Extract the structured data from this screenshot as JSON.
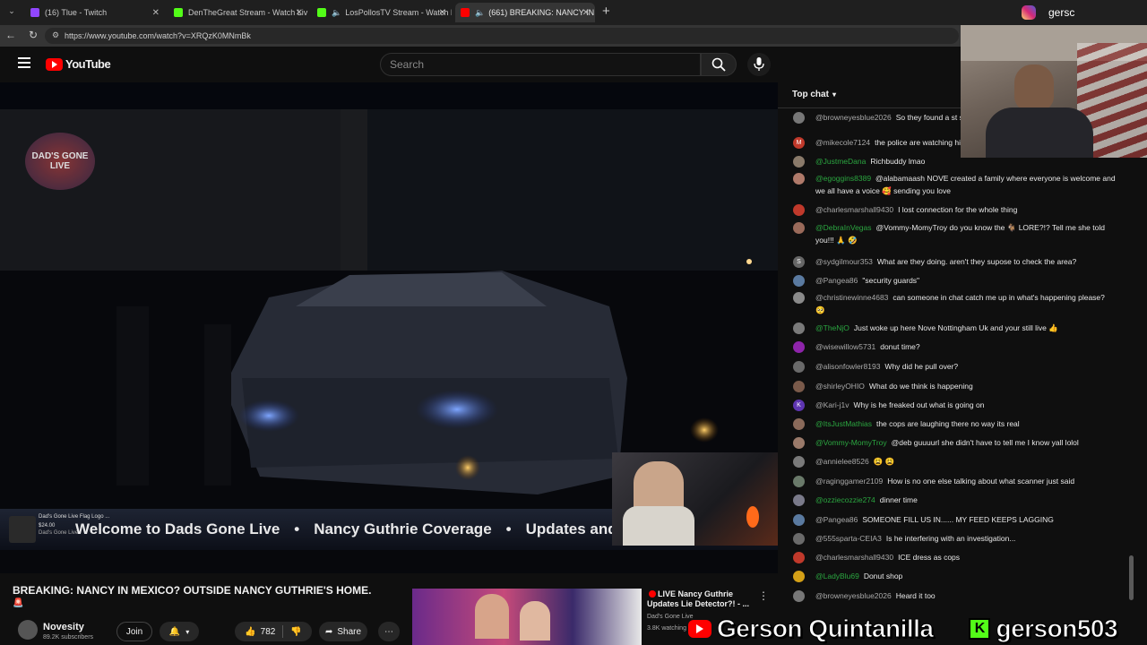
{
  "browser": {
    "tabs": [
      {
        "title": "(16) Tlue - Twitch",
        "color": "#9146ff"
      },
      {
        "title": "DenTheGreat Stream - Watch Liv",
        "color": "#53fc18"
      },
      {
        "title": "LosPollosTV Stream - Watch L",
        "color": "#53fc18"
      },
      {
        "title": "(661) BREAKING: NANCY IN",
        "color": "#ff0000"
      }
    ],
    "new_tab": "+",
    "url": "https://www.youtube.com/watch?v=XRQzK0MNmBk"
  },
  "youtube": {
    "logo_text": "YouTube",
    "search_placeholder": "Search"
  },
  "video": {
    "watermark": "DAD'S GONE LIVE",
    "ticker_items": [
      "Welcome to Dads Gone Live",
      "•",
      "Nancy Guthrie Coverage",
      "•",
      "Updates and N"
    ],
    "ticker_logo_line1": "Dad's Gone Live Flag Logo ...",
    "ticker_logo_line2": "$24.00",
    "ticker_logo_line3": "Dad's Gone Live"
  },
  "info": {
    "title": "BREAKING: NANCY IN MEXICO? OUTSIDE NANCY GUTHRIE'S HOME.",
    "channel": "Novesity",
    "subscribers": "89.2K subscribers",
    "join": "Join",
    "likes": "782",
    "share": "Share",
    "rec_title": "LIVE Nancy Guthrie Updates Lie Detector?! - ...",
    "rec_channel": "Dad's Gone Live",
    "rec_viewers": "3.8K watching"
  },
  "chat": {
    "header": "Top chat",
    "messages": [
      {
        "user": "@browneyesblue2026",
        "text": "So they found a st scanner said.",
        "avatar": "#777",
        "initial": ""
      },
      {
        "user": "@mikecole7124",
        "text": "the police are watching his feet",
        "avatar": "#c0392b",
        "initial": "M"
      },
      {
        "user": "@JustmeDana",
        "text": "Richbuddy lmao",
        "avatar": "#8a7a6a",
        "initial": "",
        "member": true
      },
      {
        "user": "@egoggins8389",
        "text": "@alabamaash NOVE created a family where everyone is welcome and we all have a voice 🥰 sending you love",
        "avatar": "#b07a6a",
        "initial": "",
        "member": true
      },
      {
        "user": "@charlesmarshall9430",
        "text": "I lost connection for the whole thing",
        "avatar": "#c0392b",
        "initial": ""
      },
      {
        "user": "@DebraInVegas",
        "text": "@Vommy-MomyTroy do you know the 🐐 LORE?!? Tell me she told you!!! 🙏 🤣",
        "avatar": "#9a6a5a",
        "initial": "",
        "member": true
      },
      {
        "user": "@sydgilmour353",
        "text": "What are they doing. aren't they supose to check the area?",
        "avatar": "#666",
        "initial": "S"
      },
      {
        "user": "@Pangea86",
        "text": "\"security guards\"",
        "avatar": "#5a7aa0",
        "initial": ""
      },
      {
        "user": "@christinewinne4683",
        "text": "can someone in chat catch me up in what's happening please? 🥺",
        "avatar": "#8a8a8a",
        "initial": ""
      },
      {
        "user": "@TheNjO",
        "text": "Just woke up here Nove Nottingham Uk and your still live 👍",
        "avatar": "#7a7a7a",
        "initial": "",
        "member": true
      },
      {
        "user": "@wisewillow5731",
        "text": "donut time?",
        "avatar": "#8e24aa",
        "initial": ""
      },
      {
        "user": "@alisonfowler8193",
        "text": "Why did he pull over?",
        "avatar": "#6a6a6a",
        "initial": ""
      },
      {
        "user": "@shirleyOHIO",
        "text": "What do we think is happening",
        "avatar": "#7a5a4a",
        "initial": ""
      },
      {
        "user": "@Kari-j1v",
        "text": "Why is he freaked out what is going on",
        "avatar": "#5e35b1",
        "initial": "K"
      },
      {
        "user": "@ItsJustMathias",
        "text": "the cops are laughing there no way its real",
        "avatar": "#8a6a5a",
        "initial": "",
        "member": true
      },
      {
        "user": "@Vommy-MomyTroy",
        "text": "@deb guuuurl she didn't have to tell me I know yall lolol",
        "avatar": "#9a7a6a",
        "initial": "",
        "member": true
      },
      {
        "user": "@annielee8526",
        "text": "😩 😩",
        "avatar": "#7a7a7a",
        "initial": ""
      },
      {
        "user": "@raginggamer2109",
        "text": "How is no one else talking about what scanner just said",
        "avatar": "#6a7a6a",
        "initial": ""
      },
      {
        "user": "@ozziecozzie274",
        "text": "dinner time",
        "avatar": "#7a7a8a",
        "initial": "",
        "member": true
      },
      {
        "user": "@Pangea86",
        "text": "SOMEONE FILL US IN...... MY FEED KEEPS LAGGING",
        "avatar": "#5a7aa0",
        "initial": ""
      },
      {
        "user": "@555sparta-CEIA3",
        "text": "Is he interfering with an investigation...",
        "avatar": "#6a6a6a",
        "initial": ""
      },
      {
        "user": "@charlesmarshall9430",
        "text": "ICE dress as cops",
        "avatar": "#c0392b",
        "initial": ""
      },
      {
        "user": "@LadyBlu69",
        "text": "Donut shop",
        "avatar": "#d4a017",
        "initial": "",
        "member": true
      },
      {
        "user": "@browneyesblue2026",
        "text": "Heard it too",
        "avatar": "#777",
        "initial": ""
      }
    ]
  },
  "overlay": {
    "instagram_handle": "gersc",
    "youtube_name": "Gerson Quintanilla",
    "kick_name": "gerson503"
  }
}
